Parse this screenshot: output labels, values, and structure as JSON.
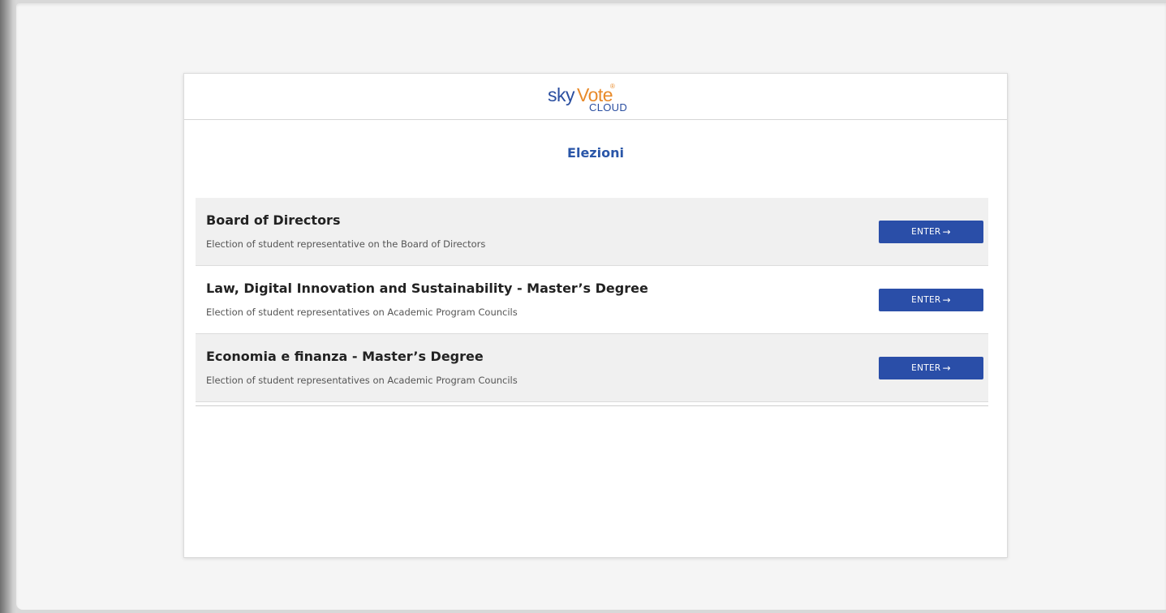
{
  "logo": {
    "sky": "sky",
    "vote": "Vote",
    "mark": "®",
    "cloud": "CLOUD"
  },
  "page": {
    "title": "Elezioni"
  },
  "elections": [
    {
      "title": "Board of Directors",
      "description": "Election of student representative on the Board of Directors",
      "button_label": "ENTER",
      "button_icon": "→"
    },
    {
      "title": "Law, Digital Innovation and Sustainability - Master’s Degree",
      "description": "Election of student representatives on Academic Program Councils",
      "button_label": "ENTER",
      "button_icon": "→"
    },
    {
      "title": "Economia e finanza - Master’s Degree",
      "description": "Election of student representatives on Academic Program Councils",
      "button_label": "ENTER",
      "button_icon": "→"
    }
  ],
  "colors": {
    "brand_blue": "#2a4ea0",
    "brand_orange": "#e88a2a",
    "button_blue": "#2a4ea8",
    "title_blue": "#2a56a8"
  }
}
